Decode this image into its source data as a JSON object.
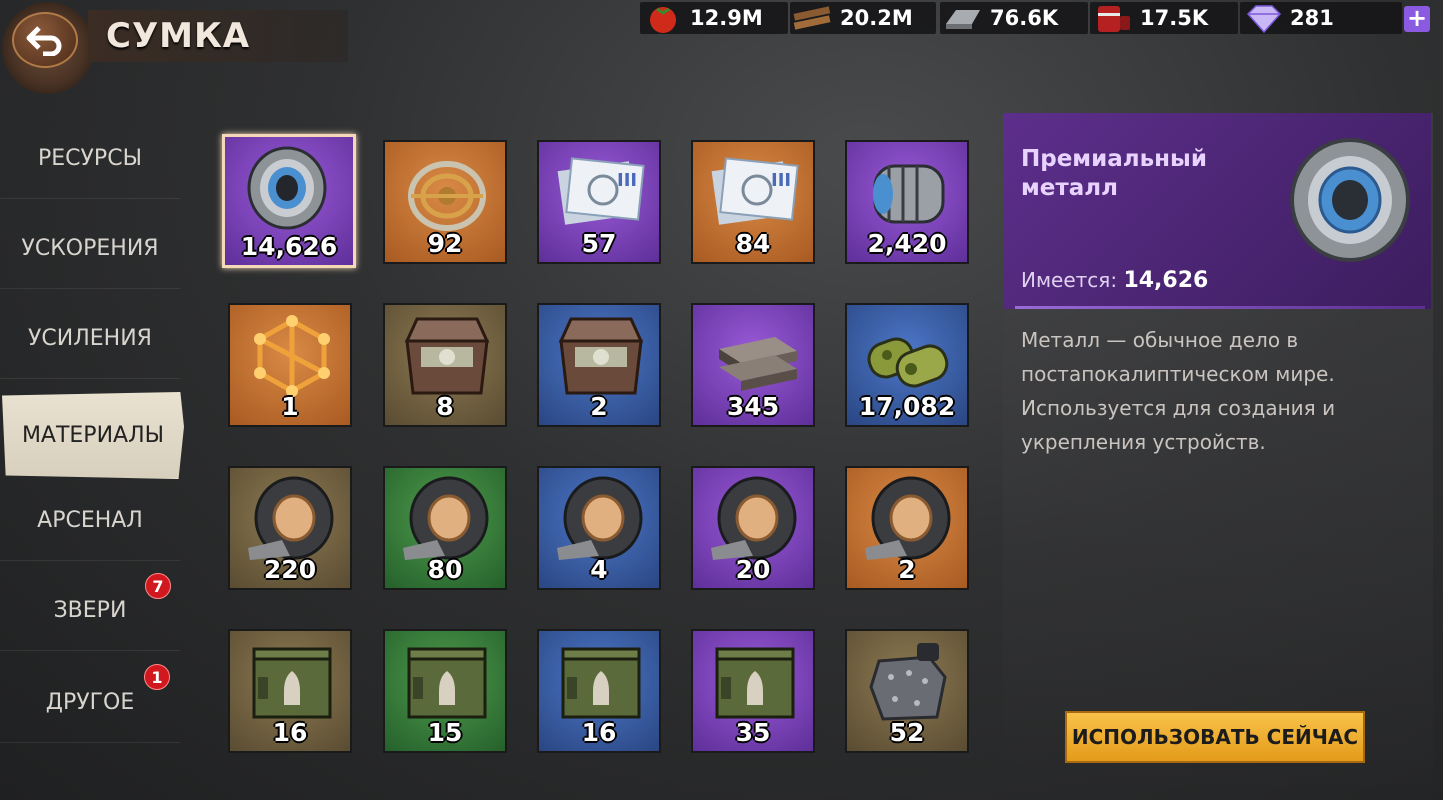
{
  "header": {
    "title": "СУМКА"
  },
  "resources": [
    {
      "name": "food",
      "value": "12.9M",
      "icon": "tomato-icon"
    },
    {
      "name": "wood",
      "value": "20.2M",
      "icon": "wood-planks-icon"
    },
    {
      "name": "steel",
      "value": "76.6K",
      "icon": "steel-ingot-icon"
    },
    {
      "name": "fuel",
      "value": "17.5K",
      "icon": "fuel-barrel-icon"
    },
    {
      "name": "diamonds",
      "value": "281",
      "icon": "diamond-icon"
    }
  ],
  "plus_label": "+",
  "tabs": [
    {
      "label": "РЕСУРСЫ",
      "badge": ""
    },
    {
      "label": "УСКОРЕНИЯ",
      "badge": ""
    },
    {
      "label": "УСИЛЕНИЯ",
      "badge": ""
    },
    {
      "label": "МАТЕРИАЛЫ",
      "badge": "",
      "active": true
    },
    {
      "label": "АРСЕНАЛ",
      "badge": ""
    },
    {
      "label": "ЗВЕРИ",
      "badge": "7"
    },
    {
      "label": "ДРУГОЕ",
      "badge": "1"
    }
  ],
  "items": [
    {
      "count": "14,626",
      "rarity": "purple",
      "icon": "bearing-icon",
      "selected": true
    },
    {
      "count": "92",
      "rarity": "orange",
      "icon": "gyroscope-icon"
    },
    {
      "count": "57",
      "rarity": "purple",
      "icon": "blueprint-icon"
    },
    {
      "count": "84",
      "rarity": "orange",
      "icon": "blueprint-icon"
    },
    {
      "count": "2,420",
      "rarity": "purple",
      "icon": "roller-icon"
    },
    {
      "count": "1",
      "rarity": "orange",
      "icon": "molecule-icon"
    },
    {
      "count": "8",
      "rarity": "olive",
      "icon": "supply-crate-icon"
    },
    {
      "count": "2",
      "rarity": "blue",
      "icon": "supply-crate-icon"
    },
    {
      "count": "345",
      "rarity": "purple",
      "icon": "metal-plates-icon"
    },
    {
      "count": "17,082",
      "rarity": "blue",
      "icon": "camo-cloth-icon"
    },
    {
      "count": "220",
      "rarity": "olive",
      "icon": "tape-roll-icon"
    },
    {
      "count": "80",
      "rarity": "green",
      "icon": "tape-roll-icon"
    },
    {
      "count": "4",
      "rarity": "blue",
      "icon": "tape-roll-icon"
    },
    {
      "count": "20",
      "rarity": "purple",
      "icon": "tape-roll-icon"
    },
    {
      "count": "2",
      "rarity": "orange",
      "icon": "tape-roll-icon"
    },
    {
      "count": "16",
      "rarity": "olive",
      "icon": "ammo-box-icon"
    },
    {
      "count": "15",
      "rarity": "green",
      "icon": "ammo-box-icon"
    },
    {
      "count": "16",
      "rarity": "blue",
      "icon": "ammo-box-icon"
    },
    {
      "count": "35",
      "rarity": "purple",
      "icon": "ammo-box-icon"
    },
    {
      "count": "52",
      "rarity": "olive",
      "icon": "armor-plate-icon"
    }
  ],
  "detail": {
    "name": "Премиальный металл",
    "owned_label": "Имеется:",
    "owned_value": "14,626",
    "description": "Металл — обычное дело в постапокалиптическом мире. Используется для создания и укрепления устройств.",
    "use_button": "ИСПОЛЬЗОВАТЬ СЕЙЧАС"
  }
}
